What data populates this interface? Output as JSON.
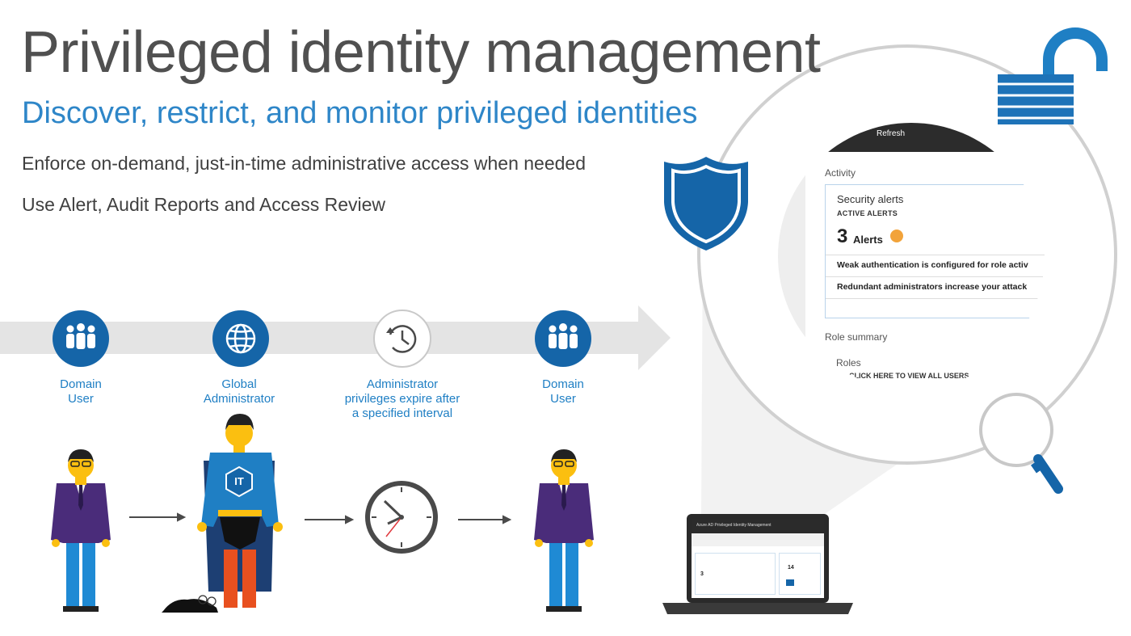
{
  "header": {
    "title": "Privileged identity management",
    "subtitle": "Discover, restrict, and monitor privileged identities",
    "bullets": [
      "Enforce on-demand, just-in-time administrative access when needed",
      "Use Alert, Audit Reports and Access Review"
    ]
  },
  "flow": {
    "steps": [
      {
        "label_lines": [
          "Domain",
          "User"
        ],
        "icon": "users-group-icon"
      },
      {
        "label_lines": [
          "Global",
          "Administrator"
        ],
        "icon": "globe-icon"
      },
      {
        "label_lines": [
          "Administrator",
          "privileges expire after",
          "a specified interval"
        ],
        "icon": "history-clock-icon"
      },
      {
        "label_lines": [
          "Domain",
          "User"
        ],
        "icon": "users-group-icon"
      }
    ],
    "badge_text": "IT"
  },
  "zoom_panel": {
    "refresh_label": "Refresh",
    "activity_heading": "Activity",
    "security_alerts_title": "Security alerts",
    "active_alerts_label": "ACTIVE ALERTS",
    "alert_count": "3",
    "alert_count_label": "Alerts",
    "alert_rows": [
      "Weak authentication is configured for role activ",
      "Redundant administrators increase your attack"
    ],
    "role_summary_heading": "Role summary",
    "roles_heading": "Roles",
    "view_all_link": "CLICK HERE TO VIEW ALL USERS"
  },
  "laptop": {
    "window_title": "Azure AD Privileged Identity Management",
    "alert_count": "3",
    "users_count": "14"
  },
  "colors": {
    "accent_blue": "#2e86c8",
    "dark_blue": "#1565a8",
    "title_gray": "#505050",
    "arrow_gray": "#e4e4e4",
    "suit_purple": "#4a2c7a",
    "pants_blue": "#1f8ad4",
    "skin_yellow": "#fbbf10",
    "cape_navy": "#1d3f73",
    "hero_pants_red": "#e8501f"
  }
}
